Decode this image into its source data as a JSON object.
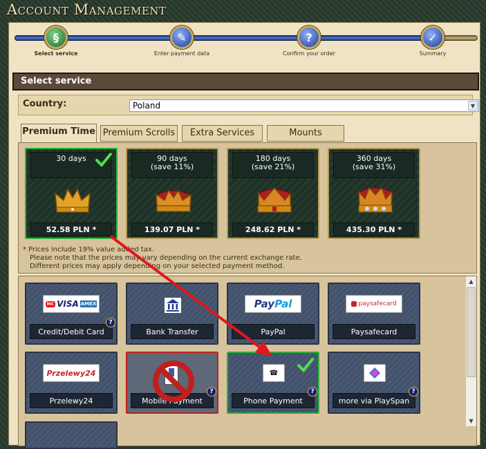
{
  "window": {
    "title": "Account Management"
  },
  "progress": {
    "steps": [
      {
        "label": "Select service",
        "icon": "scroll-check-icon"
      },
      {
        "label": "Enter payment data",
        "icon": "scroll-quill-icon"
      },
      {
        "label": "Confirm your order",
        "icon": "question-icon"
      },
      {
        "label": "Summary",
        "icon": "checkmark-icon"
      }
    ]
  },
  "section": {
    "title": "Select service"
  },
  "country": {
    "label": "Country:",
    "value": "Poland"
  },
  "tabs": [
    {
      "label": "Premium Time"
    },
    {
      "label": "Premium Scrolls"
    },
    {
      "label": "Extra Services"
    },
    {
      "label": "Mounts"
    }
  ],
  "offers": [
    {
      "line1": "30 days",
      "line2": "",
      "price": "52.58 PLN *"
    },
    {
      "line1": "90 days",
      "line2": "(save 11%)",
      "price": "139.07 PLN *"
    },
    {
      "line1": "180 days",
      "line2": "(save 21%)",
      "price": "248.62 PLN *"
    },
    {
      "line1": "360 days",
      "line2": "(save 31%)",
      "price": "435.30 PLN *"
    }
  ],
  "notes": [
    "* Prices include 19% value added tax.",
    "Please note that the prices may vary depending on the current exchange rate.",
    "Different prices may apply depending on your selected payment method."
  ],
  "payments": [
    {
      "label": "Credit/Debit Card",
      "logo": "MasterCard VISA AMEX"
    },
    {
      "label": "Bank Transfer",
      "logo": "bank-icon"
    },
    {
      "label": "PayPal",
      "logo": "PayPal"
    },
    {
      "label": "Paysafecard",
      "logo": "paysafecard"
    },
    {
      "label": "Przelewy24",
      "logo": "Przelewy24"
    },
    {
      "label": "Mobile Payment",
      "logo": "mobile-phone-icon"
    },
    {
      "label": "Phone Payment",
      "logo": "telephone-icon"
    },
    {
      "label": "more via PlaySpan",
      "logo": "playspan-icon"
    }
  ],
  "colors": {
    "selected_border": "#28b33a",
    "annotation_arrow": "#e3161c",
    "forbidden": "#c0201d"
  }
}
